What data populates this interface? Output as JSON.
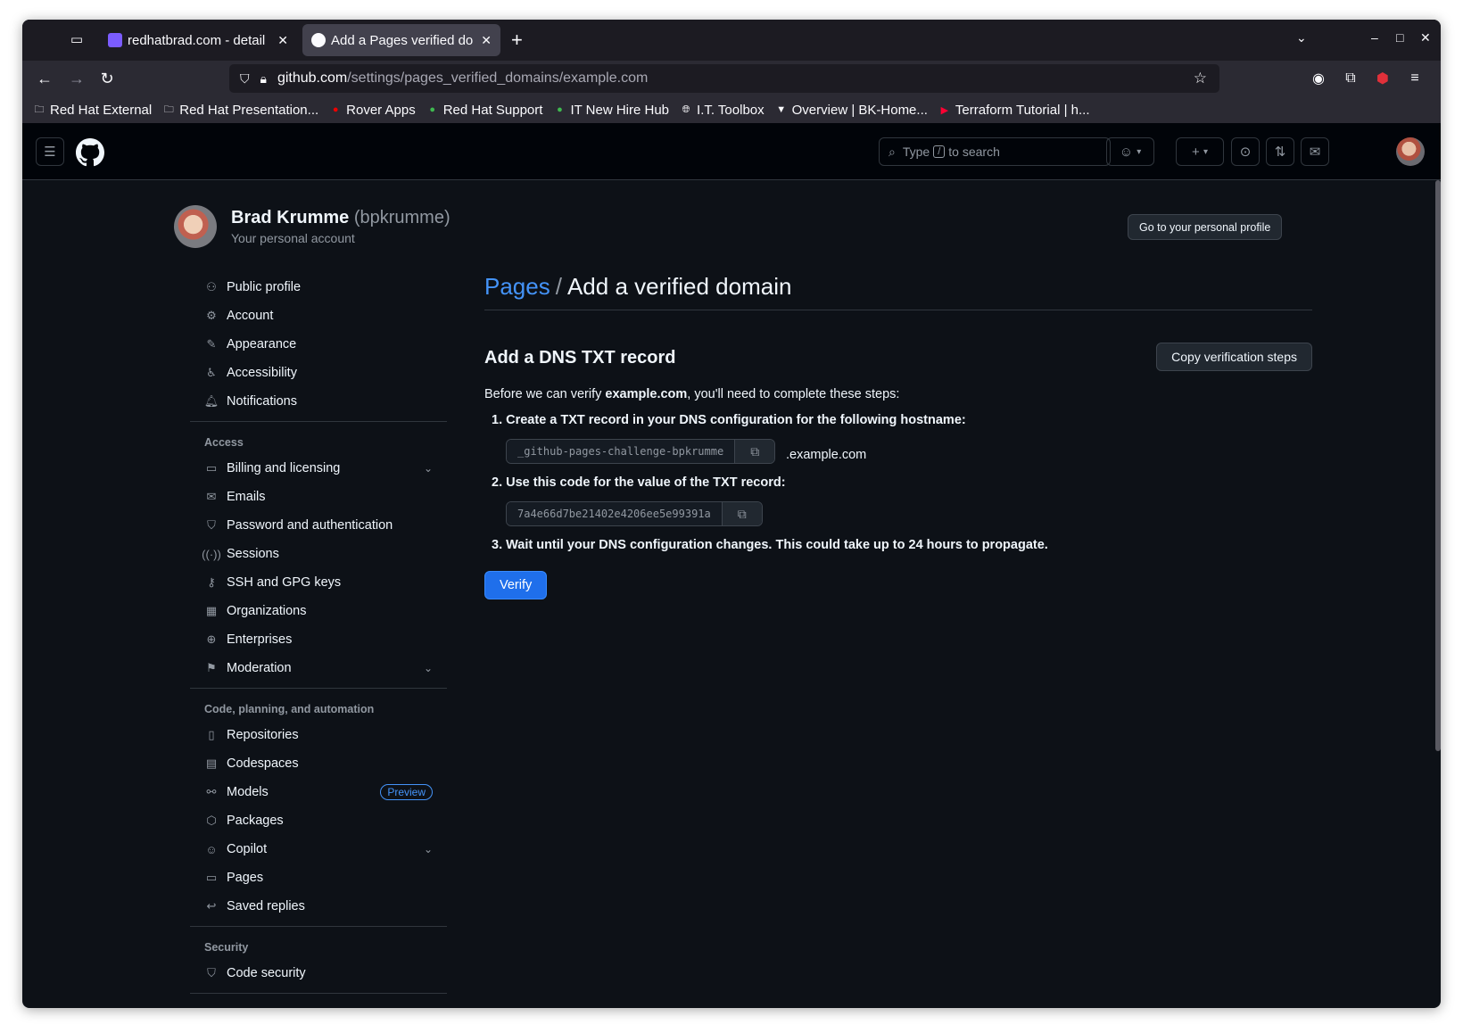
{
  "browser": {
    "tabs": [
      {
        "title": "redhatbrad.com - detail",
        "favicon_color": "#7b5cff",
        "active": false
      },
      {
        "title": "Add a Pages verified do",
        "favicon_color": "#fbfbfe",
        "active": true
      }
    ],
    "url_host": "github.com",
    "url_path": "/settings/pages_verified_domains/example.com",
    "bookmarks": [
      {
        "label": "Red Hat External",
        "icon": "folder-icon"
      },
      {
        "label": "Red Hat Presentation...",
        "icon": "folder-icon"
      },
      {
        "label": "Rover Apps",
        "icon": "redhat-icon"
      },
      {
        "label": "Red Hat Support",
        "icon": "green-circle-icon"
      },
      {
        "label": "IT New Hire Hub",
        "icon": "green-circle-icon"
      },
      {
        "label": "I.T. Toolbox",
        "icon": "globe-icon"
      },
      {
        "label": "Overview | BK-Home...",
        "icon": "terraform-icon"
      },
      {
        "label": "Terraform Tutorial | h...",
        "icon": "youtube-icon"
      }
    ]
  },
  "github": {
    "search_placeholder_pre": "Type",
    "search_key": "/",
    "search_placeholder_post": "to search"
  },
  "profile": {
    "name": "Brad Krumme",
    "handle": "(bpkrumme)",
    "subtitle": "Your personal account",
    "go_profile_label": "Go to your personal profile"
  },
  "sidebar": {
    "group1": [
      {
        "label": "Public profile",
        "icon": "person-icon"
      },
      {
        "label": "Account",
        "icon": "gear-icon"
      },
      {
        "label": "Appearance",
        "icon": "paintbrush-icon"
      },
      {
        "label": "Accessibility",
        "icon": "accessibility-icon"
      },
      {
        "label": "Notifications",
        "icon": "bell-icon"
      }
    ],
    "access_heading": "Access",
    "access": [
      {
        "label": "Billing and licensing",
        "icon": "credit-card-icon",
        "chevron": true
      },
      {
        "label": "Emails",
        "icon": "mail-icon"
      },
      {
        "label": "Password and authentication",
        "icon": "shield-lock-icon"
      },
      {
        "label": "Sessions",
        "icon": "broadcast-icon"
      },
      {
        "label": "SSH and GPG keys",
        "icon": "key-icon"
      },
      {
        "label": "Organizations",
        "icon": "organization-icon"
      },
      {
        "label": "Enterprises",
        "icon": "globe-icon"
      },
      {
        "label": "Moderation",
        "icon": "report-icon",
        "chevron": true
      }
    ],
    "code_heading": "Code, planning, and automation",
    "code": [
      {
        "label": "Repositories",
        "icon": "repo-icon"
      },
      {
        "label": "Codespaces",
        "icon": "codespaces-icon"
      },
      {
        "label": "Models",
        "icon": "models-icon",
        "badge": "Preview"
      },
      {
        "label": "Packages",
        "icon": "package-icon"
      },
      {
        "label": "Copilot",
        "icon": "copilot-icon",
        "chevron": true
      },
      {
        "label": "Pages",
        "icon": "browser-icon"
      },
      {
        "label": "Saved replies",
        "icon": "reply-icon"
      }
    ],
    "security_heading": "Security",
    "security": [
      {
        "label": "Code security",
        "icon": "shield-icon"
      }
    ]
  },
  "main": {
    "breadcrumb_link": "Pages",
    "breadcrumb_sep": "/",
    "breadcrumb_current": "Add a verified domain",
    "section_title": "Add a DNS TXT record",
    "copy_steps_label": "Copy verification steps",
    "intro_pre": "Before we can verify ",
    "intro_domain": "example.com",
    "intro_post": ", you'll need to complete these steps:",
    "step1": "1. Create a TXT record in your DNS configuration for the following hostname:",
    "hostname_code": "_github-pages-challenge-bpkrumme",
    "hostname_suffix": ".example.com",
    "step2": "2. Use this code for the value of the TXT record:",
    "txt_code": "7a4e66d7be21402e4206ee5e99391a",
    "step3": "3. Wait until your DNS configuration changes. This could take up to 24 hours to propagate.",
    "verify_label": "Verify"
  },
  "colors": {
    "bg": "#0d1117",
    "header_bg": "#010409",
    "accent": "#4493f8",
    "primary_button": "#1f6feb"
  }
}
